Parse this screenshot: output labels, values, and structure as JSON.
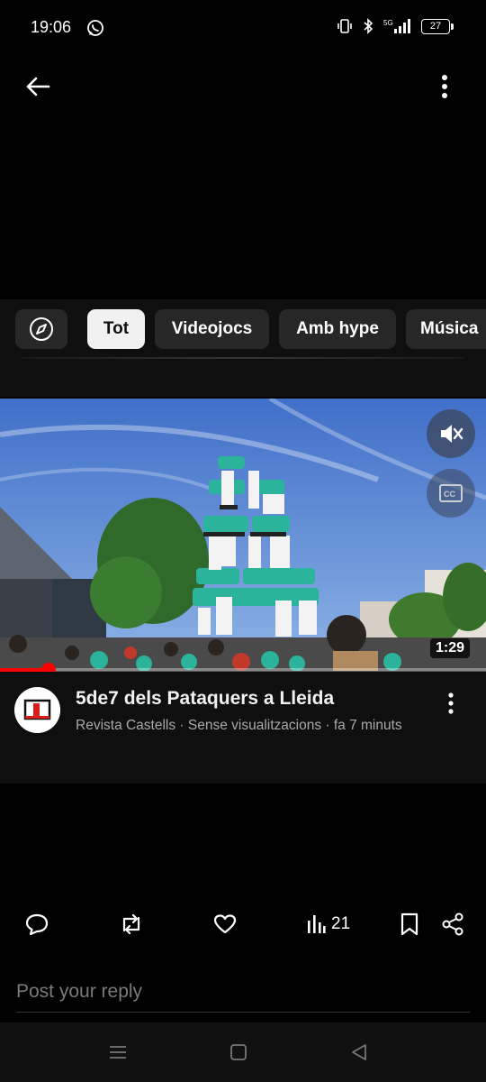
{
  "status_bar": {
    "time": "19:06",
    "battery": "27"
  },
  "chips": {
    "explore_icon": "compass-icon",
    "items": [
      {
        "label": "Tot",
        "active": true
      },
      {
        "label": "Videojocs",
        "active": false
      },
      {
        "label": "Amb hype",
        "active": false
      },
      {
        "label": "Música",
        "active": false
      }
    ]
  },
  "video": {
    "duration": "1:29",
    "progress": 0.1,
    "muted": true,
    "title": "5de7 dels Pataquers a Lleida",
    "meta": "Revista Castells · Sense visualitzacions · fa 7 minuts"
  },
  "actions": {
    "views_count": "21"
  },
  "reply": {
    "placeholder": "Post your reply"
  },
  "colors": {
    "accent": "#ff0000",
    "chip_bg": "#272727",
    "chip_active_bg": "#f1f1f1",
    "castellers_shirt": "#2bb39b"
  }
}
